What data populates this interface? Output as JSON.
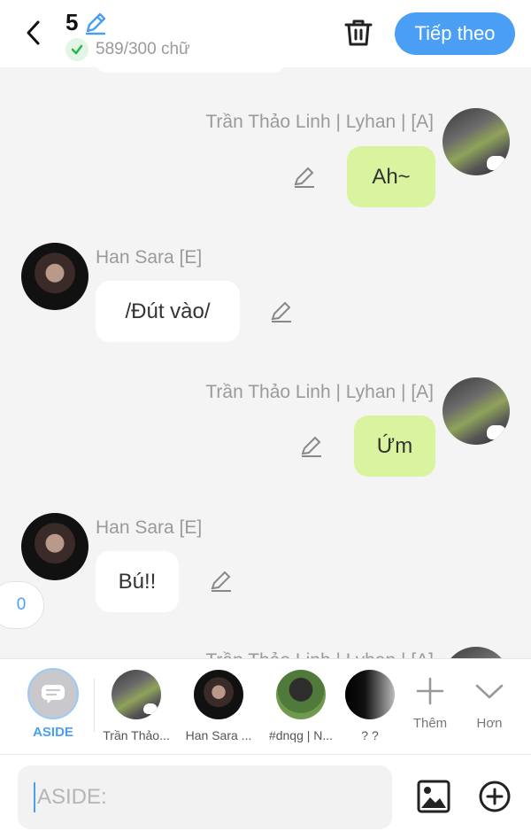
{
  "header": {
    "episode_number": "5",
    "word_count": "589/300 chữ",
    "next_label": "Tiếp theo"
  },
  "messages": [
    {
      "speaker": "Trần Thảo Linh | Lyhan | [A]",
      "text": "Ah~",
      "side": "right"
    },
    {
      "speaker": "Han Sara [E]",
      "text": "/Đút vào/",
      "side": "left"
    },
    {
      "speaker": "Trần Thảo Linh | Lyhan | [A]",
      "text": "Ứm",
      "side": "right"
    },
    {
      "speaker": "Han Sara [E]",
      "text": "Bú!!",
      "side": "left"
    },
    {
      "speaker": "Trần Thảo Linh | Lyhan | [A]",
      "text": "",
      "side": "right"
    }
  ],
  "side_counter": "0",
  "picker": {
    "aside_label": "ASIDE",
    "characters": [
      {
        "label": "Trần Thảo..."
      },
      {
        "label": "Han Sara ..."
      },
      {
        "label": "#dnqg | N..."
      },
      {
        "label": "? ?"
      }
    ],
    "add_label": "Thêm",
    "more_label": "Hơn"
  },
  "input": {
    "placeholder": "ASIDE:",
    "value": ""
  },
  "colors": {
    "accent": "#4a9ff4",
    "my_bubble": "#d9f39e",
    "their_bubble": "#ffffff",
    "background": "#f4f4f4"
  },
  "icons": {
    "back": "chevron-left-icon",
    "edit": "pencil-icon",
    "check": "check-icon",
    "delete": "trash-icon",
    "image": "image-icon",
    "add": "plus-circle-icon",
    "more": "chevron-down-icon"
  }
}
